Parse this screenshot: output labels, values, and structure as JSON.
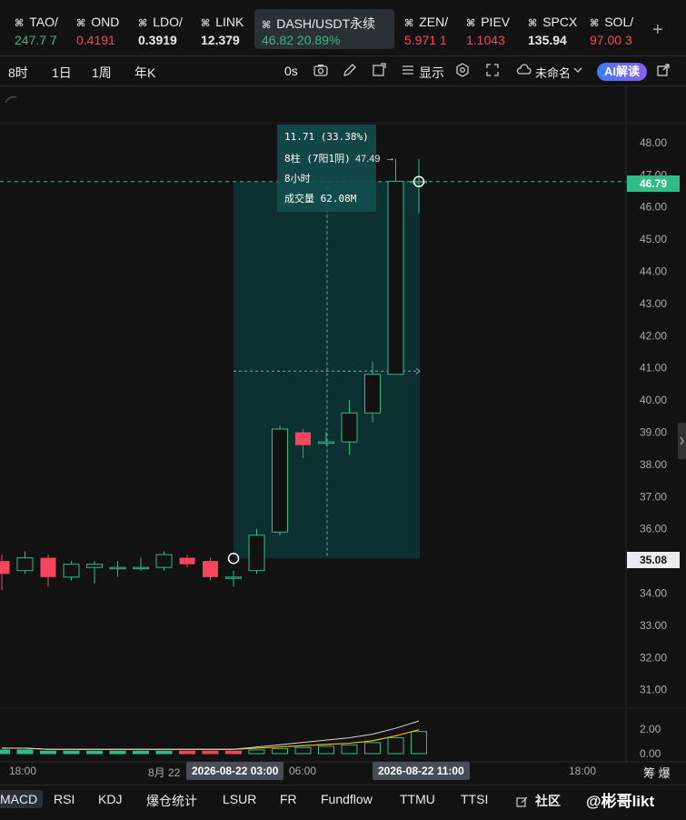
{
  "tickers": [
    {
      "symbol": "TAO/",
      "price": "247.7",
      "change": "7",
      "trend": "up"
    },
    {
      "symbol": "OND",
      "price": "0.4191",
      "change": "",
      "trend": "down"
    },
    {
      "symbol": "LDO/",
      "price": "0.3919",
      "change": "",
      "trend": "flat"
    },
    {
      "symbol": "LINK",
      "price": "12.379",
      "change": "",
      "trend": "flat"
    },
    {
      "symbol": "DASH/USDT永续",
      "price": "46.82",
      "change": "20.89%",
      "trend": "up"
    },
    {
      "symbol": "ZEN/",
      "price": "5.971",
      "change": "1",
      "trend": "down"
    },
    {
      "symbol": "PIEV",
      "price": "1.1043",
      "change": "",
      "trend": "down"
    },
    {
      "symbol": "SPCX",
      "price": "135.94",
      "change": "",
      "trend": "flat"
    },
    {
      "symbol": "SOL/",
      "price": "97.00",
      "change": "3",
      "trend": "down"
    }
  ],
  "add_tab": "+",
  "toolbar": {
    "intervals": [
      "8时",
      "1日",
      "1周",
      "年K"
    ],
    "zero_s": "0s",
    "display": "显示",
    "layout_name": "未命名",
    "ai_label": "AI解读"
  },
  "price_axis": [
    "48.00",
    "47.00",
    "46.00",
    "45.00",
    "44.00",
    "43.00",
    "42.00",
    "41.00",
    "40.00",
    "39.00",
    "38.00",
    "37.00",
    "36.00",
    "35.00",
    "34.00",
    "33.00",
    "32.00",
    "31.00"
  ],
  "volume_axis": [
    "2.00",
    "0.00"
  ],
  "current_price": "46.79",
  "measure_start_price": "35.08",
  "measure_top_label": "47.49",
  "measure_box": {
    "change": "11.71 (33.38%)",
    "bars": "8柱 (7阳1阴)",
    "duration": "8小时",
    "volume": "成交量 62.08M"
  },
  "time_axis": {
    "labels": [
      "18:00",
      "8月 22",
      "06:00",
      "18:00"
    ],
    "pill_start": "2026-08-22 03:00",
    "pill_end": "2026-08-22 11:00",
    "right_labels": "筹 爆"
  },
  "bottom_tabs": [
    "MACD",
    "RSI",
    "KDJ",
    "爆仓统计",
    "LSUR",
    "FR",
    "Fundflow",
    "TTMU",
    "TTSI"
  ],
  "bottom_right": "社区",
  "watermark": "@彬哥likt",
  "chart_data": {
    "type": "candlestick",
    "title": "",
    "ylim": [
      30.5,
      48.5
    ],
    "candles": [
      {
        "o": 35.0,
        "c": 34.6,
        "h": 35.2,
        "l": 34.1
      },
      {
        "o": 34.7,
        "c": 35.1,
        "h": 35.3,
        "l": 34.6
      },
      {
        "o": 35.1,
        "c": 34.5,
        "h": 35.2,
        "l": 34.2
      },
      {
        "o": 34.5,
        "c": 34.9,
        "h": 35.0,
        "l": 34.4
      },
      {
        "o": 34.8,
        "c": 34.9,
        "h": 35.0,
        "l": 34.3
      },
      {
        "o": 34.8,
        "c": 34.8,
        "h": 35.0,
        "l": 34.5
      },
      {
        "o": 34.8,
        "c": 34.8,
        "h": 35.1,
        "l": 34.7
      },
      {
        "o": 34.8,
        "c": 35.2,
        "h": 35.3,
        "l": 34.7
      },
      {
        "o": 35.1,
        "c": 34.9,
        "h": 35.2,
        "l": 34.8
      },
      {
        "o": 35.0,
        "c": 34.5,
        "h": 35.1,
        "l": 34.4
      },
      {
        "o": 34.5,
        "c": 34.5,
        "h": 34.7,
        "l": 34.2
      },
      {
        "o": 34.7,
        "c": 35.8,
        "h": 36.0,
        "l": 34.6
      },
      {
        "o": 35.9,
        "c": 39.1,
        "h": 39.2,
        "l": 35.8
      },
      {
        "o": 39.0,
        "c": 38.6,
        "h": 39.1,
        "l": 38.2
      },
      {
        "o": 38.7,
        "c": 38.7,
        "h": 39.0,
        "l": 38.6
      },
      {
        "o": 38.7,
        "c": 39.6,
        "h": 40.0,
        "l": 38.3
      },
      {
        "o": 39.6,
        "c": 40.8,
        "h": 41.2,
        "l": 39.3
      },
      {
        "o": 40.8,
        "c": 46.8,
        "h": 47.5,
        "l": 40.8
      },
      {
        "o": 46.8,
        "c": 46.8,
        "h": 47.5,
        "l": 45.8
      }
    ],
    "volumes": [
      0.3,
      0.3,
      0.2,
      0.2,
      0.2,
      0.2,
      0.2,
      0.2,
      0.2,
      0.2,
      0.2,
      0.3,
      0.4,
      0.5,
      0.6,
      0.7,
      0.9,
      1.3,
      1.8
    ]
  }
}
